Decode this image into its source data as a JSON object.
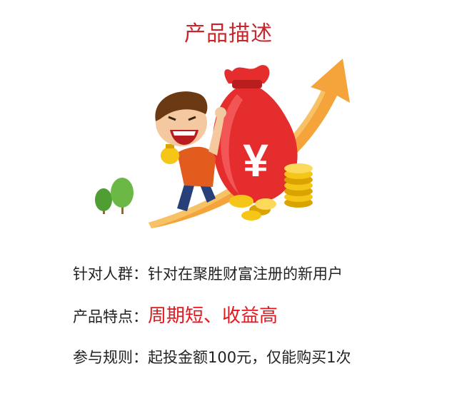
{
  "page": {
    "title": "产品描述"
  },
  "illustration": {
    "currency_symbol": "¥",
    "icons": [
      "trend-arrow-icon",
      "money-bag-icon",
      "coin-stack-icon",
      "tree-icon",
      "cartoon-man-icon"
    ]
  },
  "info": {
    "target": {
      "label": "针对人群：",
      "value": "针对在聚胜财富注册的新用户"
    },
    "features": {
      "label": "产品特点：",
      "value": "周期短、收益高"
    },
    "rules": {
      "label": "参与规则：",
      "value": "起投金额100元，仅能购买1次"
    }
  },
  "colors": {
    "title": "#c8262b",
    "highlight": "#e5161c",
    "arrow": "#f4a43a",
    "bag": "#e52d2d",
    "coin": "#f5c518",
    "tree": "#5fae3f"
  }
}
